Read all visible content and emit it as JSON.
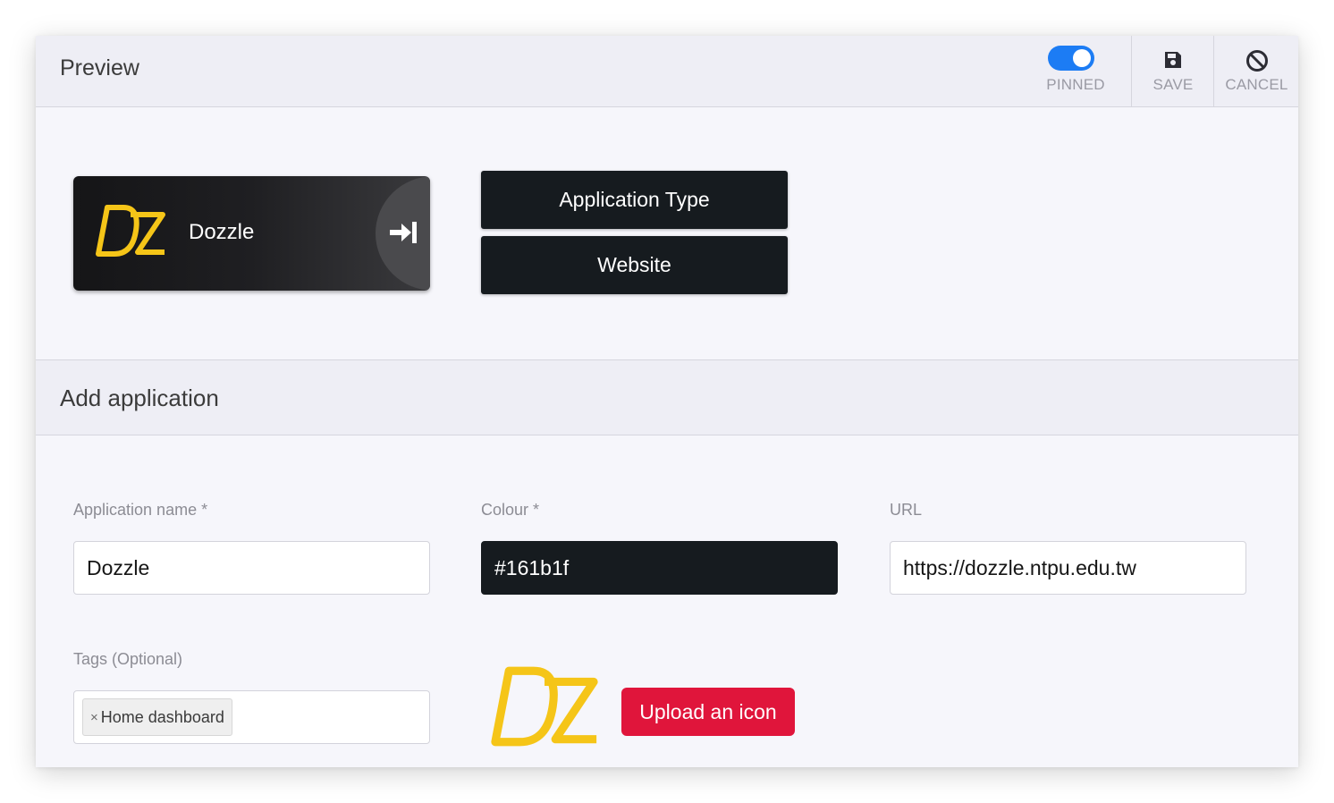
{
  "preview": {
    "title": "Preview",
    "toolbar": {
      "pinned_label": "PINNED",
      "pinned_on": true,
      "save_label": "SAVE",
      "cancel_label": "CANCEL"
    },
    "tile": {
      "name": "Dozzle",
      "logo_icon": "dozzle-logo-icon",
      "action_icon": "arrow-to-right-icon"
    },
    "buttons": {
      "application_type": "Application Type",
      "website": "Website"
    }
  },
  "add_application": {
    "title": "Add application",
    "fields": {
      "name_label": "Application name *",
      "name_value": "Dozzle",
      "colour_label": "Colour *",
      "colour_value": "#161b1f",
      "url_label": "URL",
      "url_value": "https://dozzle.ntpu.edu.tw",
      "tags_label": "Tags (Optional)",
      "tags": [
        "Home dashboard"
      ],
      "tag_remove": "×"
    },
    "upload_label": "Upload an icon"
  },
  "colors": {
    "accent_blue": "#1c7cf4",
    "app_colour": "#161b1f",
    "upload_red": "#e0153b",
    "logo_yellow": "#f5c518"
  }
}
